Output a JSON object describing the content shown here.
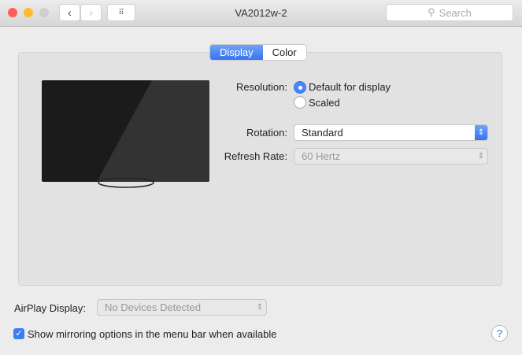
{
  "window": {
    "title": "VA2012w-2",
    "search_placeholder": "Search"
  },
  "tabs": [
    {
      "label": "Display",
      "active": true
    },
    {
      "label": "Color",
      "active": false
    }
  ],
  "resolution": {
    "label": "Resolution:",
    "options": [
      "Default for display",
      "Scaled"
    ],
    "selected": "Default for display"
  },
  "rotation": {
    "label": "Rotation:",
    "value": "Standard"
  },
  "refresh": {
    "label": "Refresh Rate:",
    "value": "60 Hertz"
  },
  "airplay": {
    "label": "AirPlay Display:",
    "value": "No Devices Detected"
  },
  "mirroring": {
    "label": "Show mirroring options in the menu bar when available",
    "checked": true
  },
  "help": "?",
  "colors": {
    "accent": "#3a72f0"
  }
}
